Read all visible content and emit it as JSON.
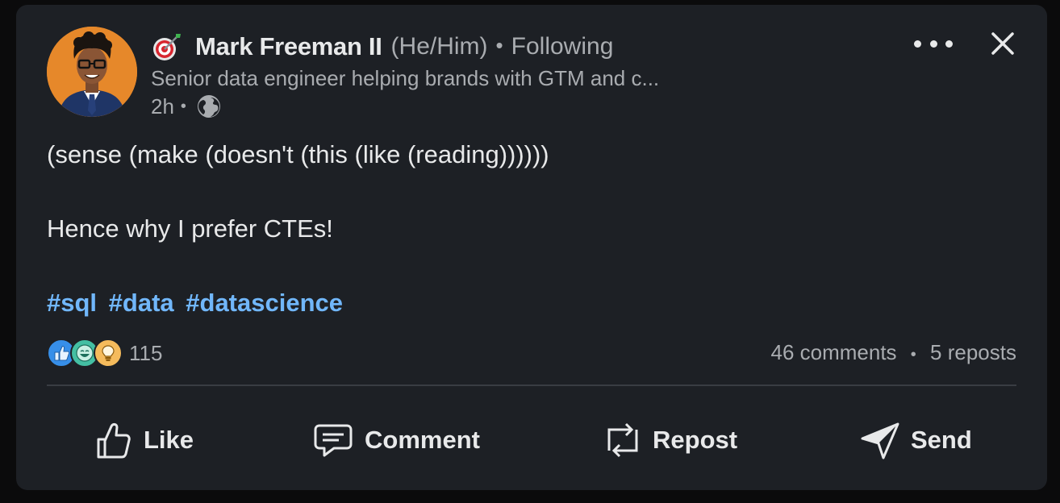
{
  "author": {
    "name": "Mark Freeman II",
    "pronouns": "(He/Him)",
    "separator": "•",
    "follow_status": "Following",
    "headline": "Senior data engineer helping brands with GTM and c...",
    "time_ago": "2h",
    "time_separator": "•",
    "visibility_icon": "globe-icon",
    "badge_icon": "target-icon"
  },
  "post": {
    "line1": "(sense (make (doesn't (this (like (reading))))))",
    "line2": "Hence why I prefer CTEs!",
    "hashtags": [
      "#sql",
      "#data",
      "#datascience"
    ]
  },
  "social": {
    "reaction_icons": [
      "like-icon",
      "funny-icon",
      "insightful-icon"
    ],
    "reaction_count": "115",
    "comments": "46 comments",
    "separator": "•",
    "reposts": "5 reposts"
  },
  "actions": {
    "like": "Like",
    "comment": "Comment",
    "repost": "Repost",
    "send": "Send"
  },
  "colors": {
    "card_background": "#1d2025",
    "hashtag_blue": "#71b7fb",
    "secondary_text": "#a9acb0",
    "avatar_background": "#e6882a"
  }
}
